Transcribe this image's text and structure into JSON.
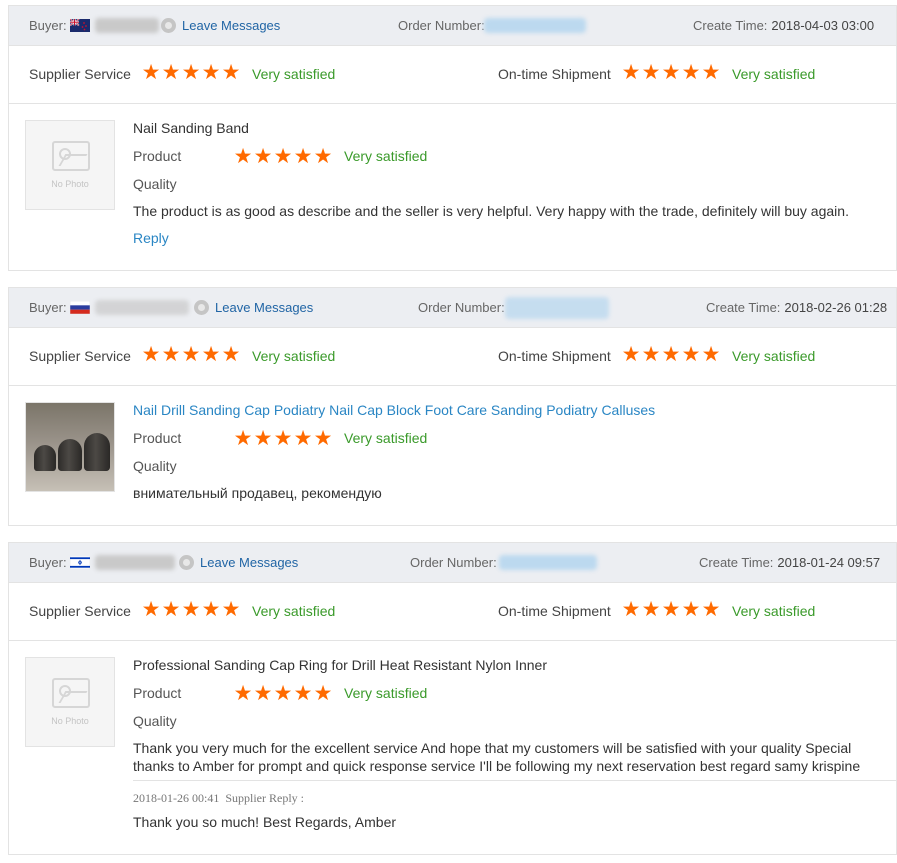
{
  "labels": {
    "buyer": "Buyer:",
    "leave_messages": "Leave Messages",
    "order_number": "Order Number:",
    "create_time": "Create Time:",
    "supplier_service": "Supplier Service",
    "ontime_shipment": "On-time Shipment",
    "product": "Product",
    "quality": "Quality",
    "reply": "Reply",
    "no_photo": "No Photo",
    "supplier_reply": "Supplier Reply :"
  },
  "colors": {
    "star": "#ff6a00",
    "satisfied": "#3a9a2a",
    "link": "#2a86c4",
    "header_bg": "#eceef2"
  },
  "icons": {
    "star": "star-icon",
    "chat": "chat-icon",
    "no_photo": "no-photo-icon"
  },
  "reviews": [
    {
      "buyer_flag": "new-zealand-flag-icon",
      "create_time": "2018-04-03 03:00",
      "supplier_service": {
        "stars": 5,
        "text": "Very satisfied"
      },
      "shipment": {
        "stars": 5,
        "text": "Very satisfied"
      },
      "product_title": "Nail Sanding Band",
      "product_rating": {
        "stars": 5,
        "text": "Very satisfied"
      },
      "comment": "The product is as good as describe and the seller is very helpful. Very happy with the trade, definitely will buy again."
    },
    {
      "buyer_flag": "russia-flag-icon",
      "create_time": "2018-02-26 01:28",
      "supplier_service": {
        "stars": 5,
        "text": "Very satisfied"
      },
      "shipment": {
        "stars": 5,
        "text": "Very satisfied"
      },
      "product_title": "Nail Drill Sanding Cap Podiatry Nail Cap Block Foot Care Sanding Podiatry Calluses",
      "product_rating": {
        "stars": 5,
        "text": "Very satisfied"
      },
      "comment": "внимательный продавец, рекомендую"
    },
    {
      "buyer_flag": "israel-flag-icon",
      "create_time": "2018-01-24 09:57",
      "supplier_service": {
        "stars": 5,
        "text": "Very satisfied"
      },
      "shipment": {
        "stars": 5,
        "text": "Very satisfied"
      },
      "product_title": "Professional Sanding Cap Ring for Drill Heat Resistant Nylon Inner",
      "product_rating": {
        "stars": 5,
        "text": "Very satisfied"
      },
      "comment": "Thank you very much for the excellent service And hope that my customers will be satisfied with your quality Special thanks to Amber for prompt and quick response service I'll be following my next reservation best regard samy krispine",
      "supplier_reply": {
        "date": "2018-01-26 00:41",
        "text": "Thank you so much! Best Regards, Amber"
      }
    }
  ]
}
